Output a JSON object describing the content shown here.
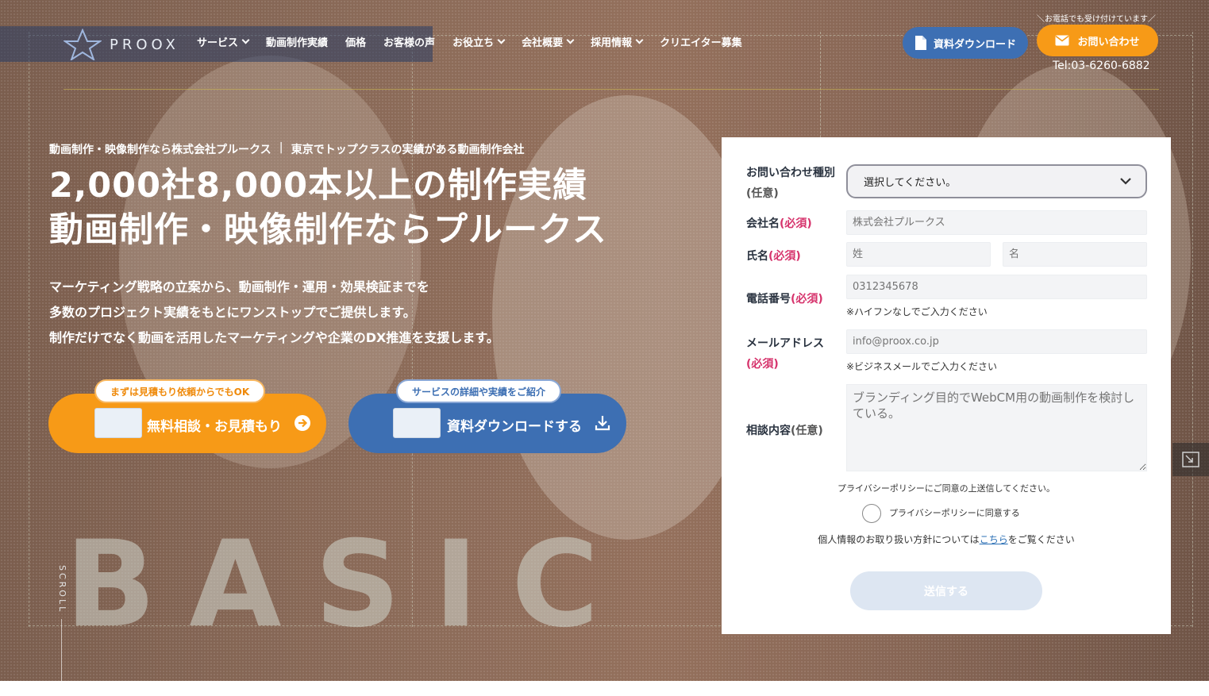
{
  "logo": {
    "text": "PROOX"
  },
  "nav": {
    "items": [
      {
        "label": "サービス",
        "dropdown": true
      },
      {
        "label": "動画制作実績",
        "dropdown": false
      },
      {
        "label": "価格",
        "dropdown": false
      },
      {
        "label": "お客様の声",
        "dropdown": false
      },
      {
        "label": "お役立ち",
        "dropdown": true
      },
      {
        "label": "会社概要",
        "dropdown": true
      },
      {
        "label": "採用情報",
        "dropdown": true
      },
      {
        "label": "クリエイター募集",
        "dropdown": false
      }
    ],
    "phone_note": "＼お電話でも受け付けています／",
    "download_button": "資料ダウンロード",
    "contact_button": "お問い合わせ",
    "tel": "Tel:03-6260-6882"
  },
  "hero": {
    "eyebrow_left": "動画制作・映像制作なら株式会社プルークス",
    "eyebrow_sep": "|",
    "eyebrow_right": "東京でトップクラスの実績がある動画制作会社",
    "headline_line1": "2,000社8,000本以上の制作実績",
    "headline_line2": "動画制作・映像制作ならプルークス",
    "lead_line1": "マーケティング戦略の立案から、動画制作・運用・効果検証までを",
    "lead_line2": "多数のプロジェクト実績をもとにワンストップでご提供します。",
    "lead_line3": "制作だけでなく動画を活用したマーケティングや企業のDX推進を支援します。",
    "cta_consult_tag": "まずは見積もり依頼からでもOK",
    "cta_consult_label": "無料相談・お見積もり",
    "cta_doc_tag": "サービスの詳細や実績をご紹介",
    "cta_doc_label": "資料ダウンロードする",
    "big_word": "BASIC",
    "scroll_label": "SCROLL"
  },
  "form": {
    "type_label": "お問い合わせ種別",
    "type_optional": "(任意)",
    "type_select_value": "選択してください。",
    "company_label": "会社名",
    "company_required": "(必須)",
    "company_placeholder": "株式会社プルークス",
    "name_label": "氏名",
    "name_required": "(必須)",
    "last_name_placeholder": "姓",
    "first_name_placeholder": "名",
    "phone_label": "電話番号",
    "phone_required": "(必須)",
    "phone_placeholder": "0312345678",
    "phone_note": "※ハイフンなしでご入力ください",
    "email_label": "メールアドレス",
    "email_required": "(必須)",
    "email_placeholder": "info@proox.co.jp",
    "email_note": "※ビジネスメールでご入力ください",
    "message_label": "相談内容",
    "message_optional": "(任意)",
    "message_placeholder": "ブランディング目的でWebCM用の動画制作を検討している。",
    "privacy_instruction": "プライバシーポリシーにご同意の上送信してください。",
    "privacy_checkbox_label": "プライバシーポリシーに同意する",
    "policy_prefix": "個人情報のお取り扱い方針については",
    "policy_link": "こちら",
    "policy_suffix": "をご覧ください",
    "submit_label": "送信する"
  },
  "colors": {
    "accent_orange": "#f79a17",
    "accent_blue": "#3d6fb3",
    "required_pink": "#d6336c",
    "link_blue": "#2a6fb5"
  },
  "icons": {
    "document": "document-icon",
    "mail": "envelope-icon",
    "arrow": "arrow-right-circle-icon",
    "download": "download-icon",
    "select": "chevron-down-icon",
    "expand": "expand-icon"
  }
}
